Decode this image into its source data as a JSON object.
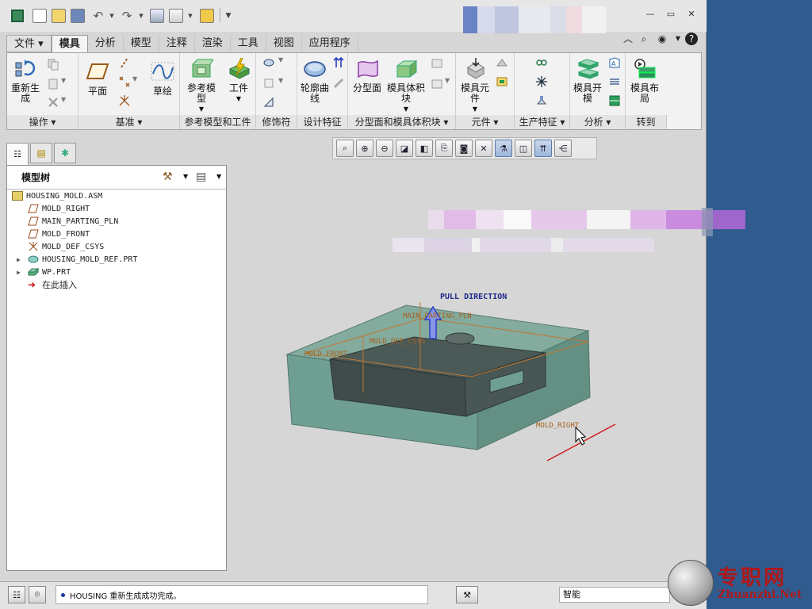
{
  "ribbon": {
    "tabs": [
      "文件",
      "模具",
      "分析",
      "模型",
      "注释",
      "渲染",
      "工具",
      "视图",
      "应用程序"
    ],
    "active_tab": "模具",
    "buttons": {
      "regenerate": "重新生成",
      "plane": "平面",
      "sketch": "草绘",
      "ref_model": "参考模型",
      "workpiece": "工件",
      "outline_curve": "轮廓曲线",
      "parting_surface": "分型面",
      "mold_volume": "模具体积块",
      "mold_component": "模具元件",
      "mold_open": "模具开模",
      "mold_layout": "模具布局"
    },
    "groups": [
      "操作",
      "基准",
      "参考模型和工件",
      "修饰符",
      "设计特征",
      "分型面和模具体积块",
      "元件",
      "生产特征",
      "分析",
      "转到"
    ]
  },
  "model_tree": {
    "title": "模型树",
    "items": [
      {
        "label": "HOUSING_MOLD.ASM",
        "icon": "assembly-icon"
      },
      {
        "label": "MOLD_RIGHT",
        "icon": "datum-plane-icon"
      },
      {
        "label": "MAIN_PARTING_PLN",
        "icon": "datum-plane-icon"
      },
      {
        "label": "MOLD_FRONT",
        "icon": "datum-plane-icon"
      },
      {
        "label": "MOLD_DEF_CSYS",
        "icon": "csys-icon"
      },
      {
        "label": "HOUSING_MOLD_REF.PRT",
        "icon": "part-icon"
      },
      {
        "label": "WP.PRT",
        "icon": "part-icon"
      },
      {
        "label": "在此插入",
        "icon": "insert-here-icon"
      }
    ]
  },
  "viewport": {
    "pull_direction": "PULL DIRECTION",
    "plane_labels": {
      "main_parting": "MAIN_PARTING_PLN",
      "front": "MOLD_FRONT",
      "csys": "MOLD_DEF_CSYS",
      "right": "MOLD_RIGHT"
    },
    "colors": {
      "mold_fill": "#6f9f92",
      "part_dark": "#3f4c4a",
      "datum": "#c07832",
      "pull_arrow": "#2a3fbf",
      "right_axis": "#d11c1c"
    }
  },
  "status": {
    "message": "HOUSING 重新生成成功完成。",
    "filter": "智能"
  },
  "watermark": {
    "title": "专职网",
    "url": "Zhuanzhi.Net"
  }
}
